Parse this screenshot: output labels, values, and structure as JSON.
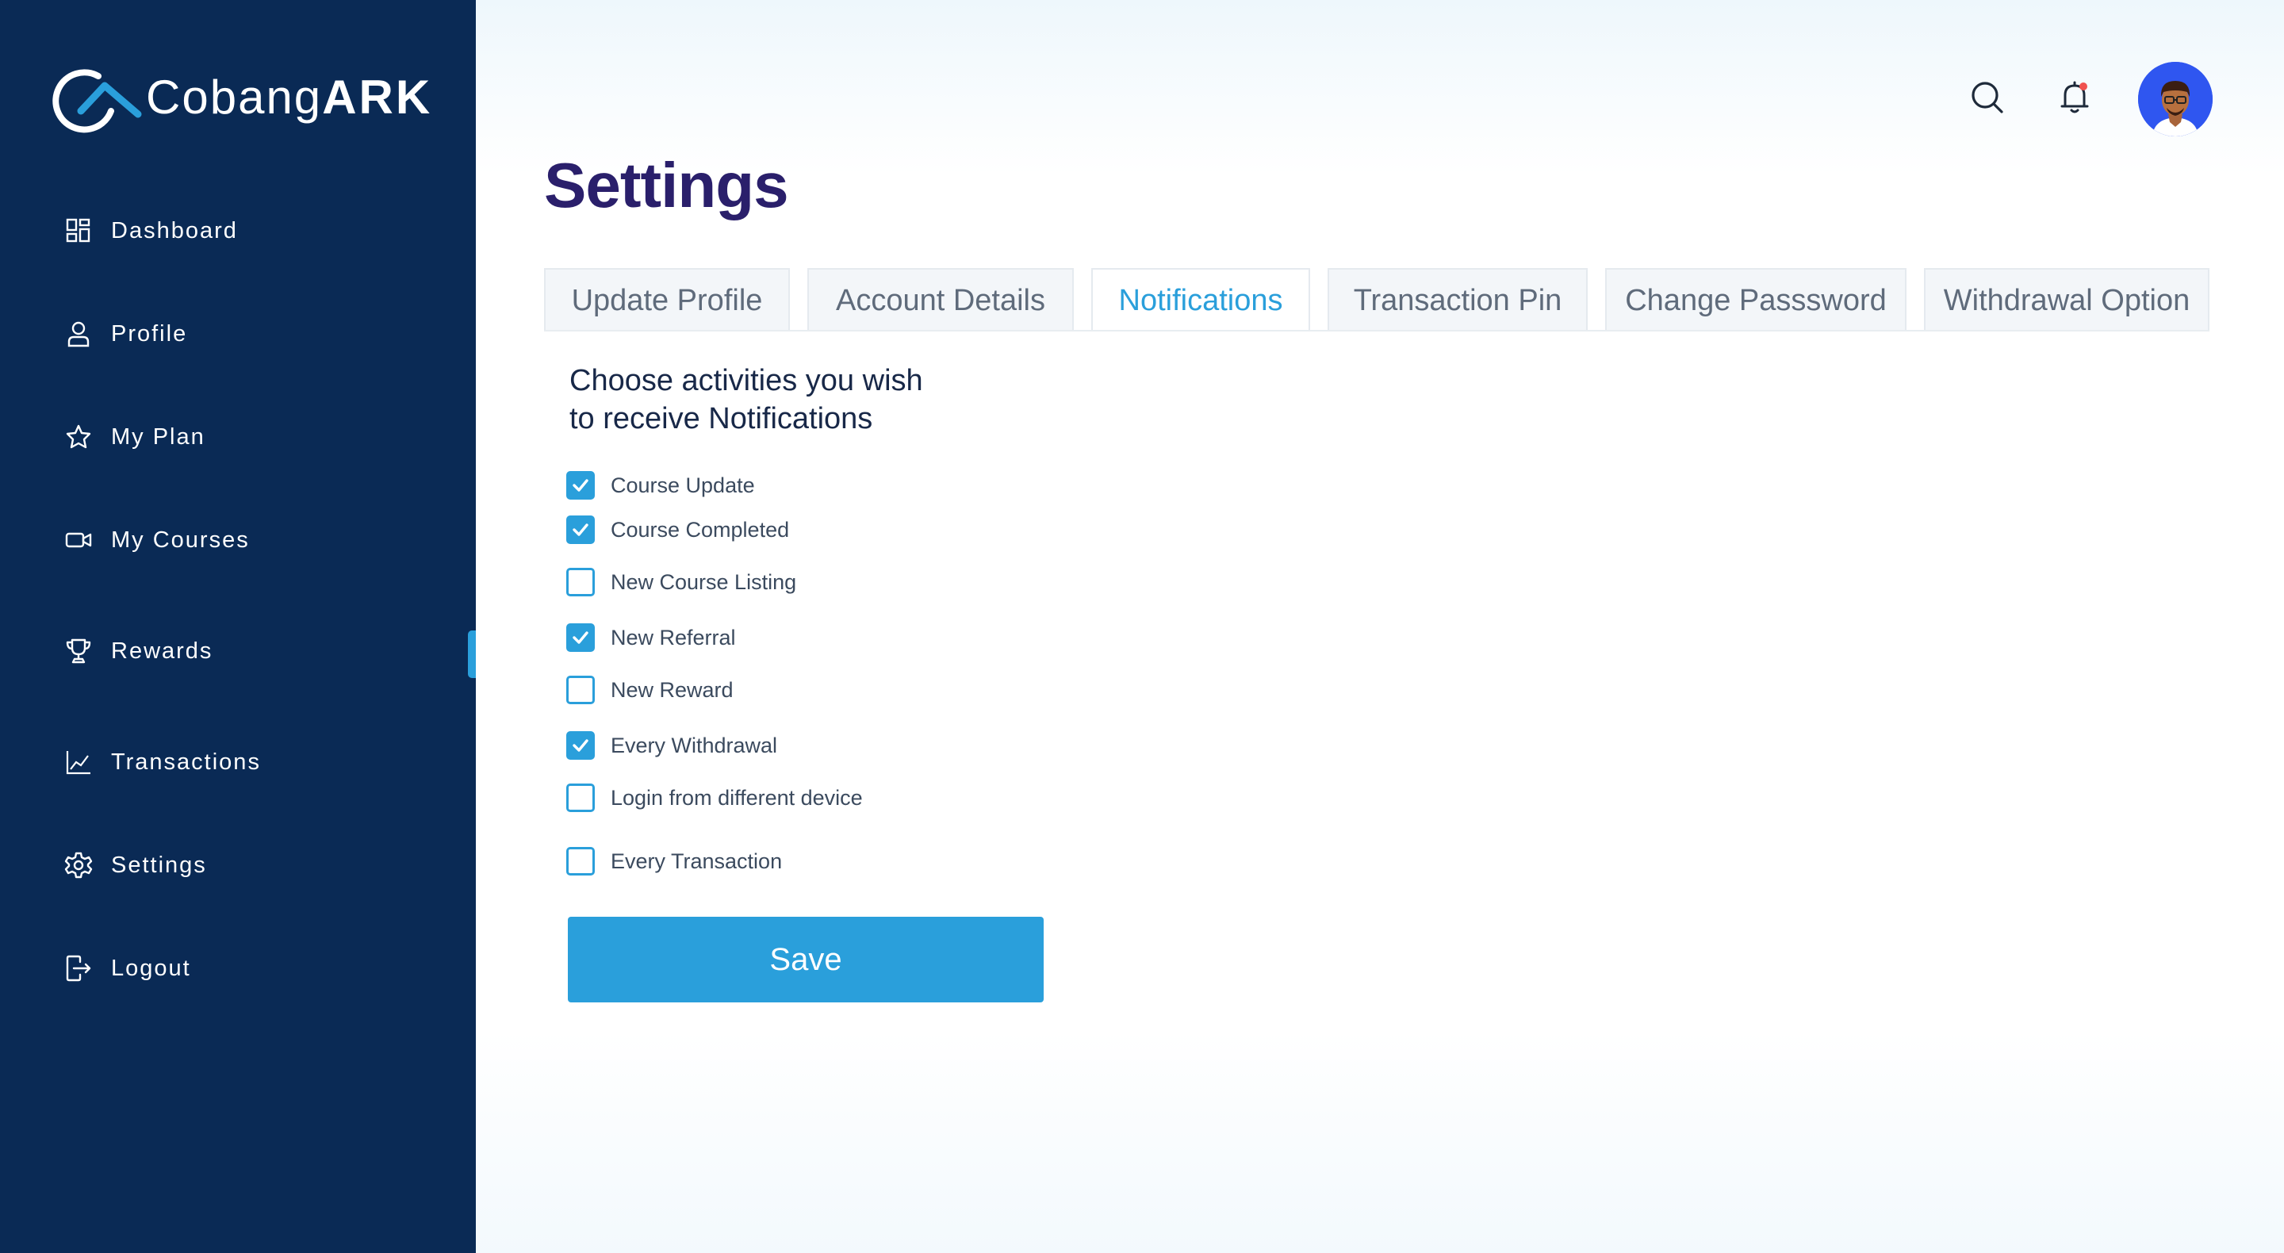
{
  "app": {
    "logo_text_light": "Cobang",
    "logo_text_bold": "ARK"
  },
  "sidebar": {
    "items": [
      {
        "label": "Dashboard",
        "icon": "dashboard-icon"
      },
      {
        "label": "Profile",
        "icon": "user-icon"
      },
      {
        "label": "My Plan",
        "icon": "star-icon"
      },
      {
        "label": "My Courses",
        "icon": "video-icon"
      },
      {
        "label": "Rewards",
        "icon": "trophy-icon"
      },
      {
        "label": "Transactions",
        "icon": "chart-icon"
      },
      {
        "label": "Settings",
        "icon": "gear-icon"
      },
      {
        "label": "Logout",
        "icon": "logout-icon"
      }
    ],
    "active": "Rewards"
  },
  "header": {
    "icons": [
      "search-icon",
      "bell-icon",
      "avatar"
    ],
    "has_notification_dot": true
  },
  "page": {
    "title": "Settings"
  },
  "tabs": [
    {
      "label": "Update Profile",
      "active": false
    },
    {
      "label": "Account Details",
      "active": false
    },
    {
      "label": "Notifications",
      "active": true
    },
    {
      "label": "Transaction Pin",
      "active": false
    },
    {
      "label": "Change Passsword",
      "active": false
    },
    {
      "label": "Withdrawal Option",
      "active": false
    }
  ],
  "notifications": {
    "heading_line1": "Choose activities you wish",
    "heading_line2": "to receive Notifications",
    "options": [
      {
        "label": "Course Update",
        "checked": true
      },
      {
        "label": "Course Completed",
        "checked": true
      },
      {
        "label": "New Course Listing",
        "checked": false
      },
      {
        "label": "New Referral",
        "checked": true
      },
      {
        "label": "New Reward",
        "checked": false
      },
      {
        "label": "Every Withdrawal",
        "checked": true
      },
      {
        "label": "Login from different device",
        "checked": false
      },
      {
        "label": "Every Transaction",
        "checked": false
      }
    ],
    "save_label": "Save"
  },
  "colors": {
    "sidebar_bg": "#0a2a55",
    "accent": "#2a9fdb",
    "title": "#2a1f6b",
    "notification_dot": "#f0524f"
  }
}
